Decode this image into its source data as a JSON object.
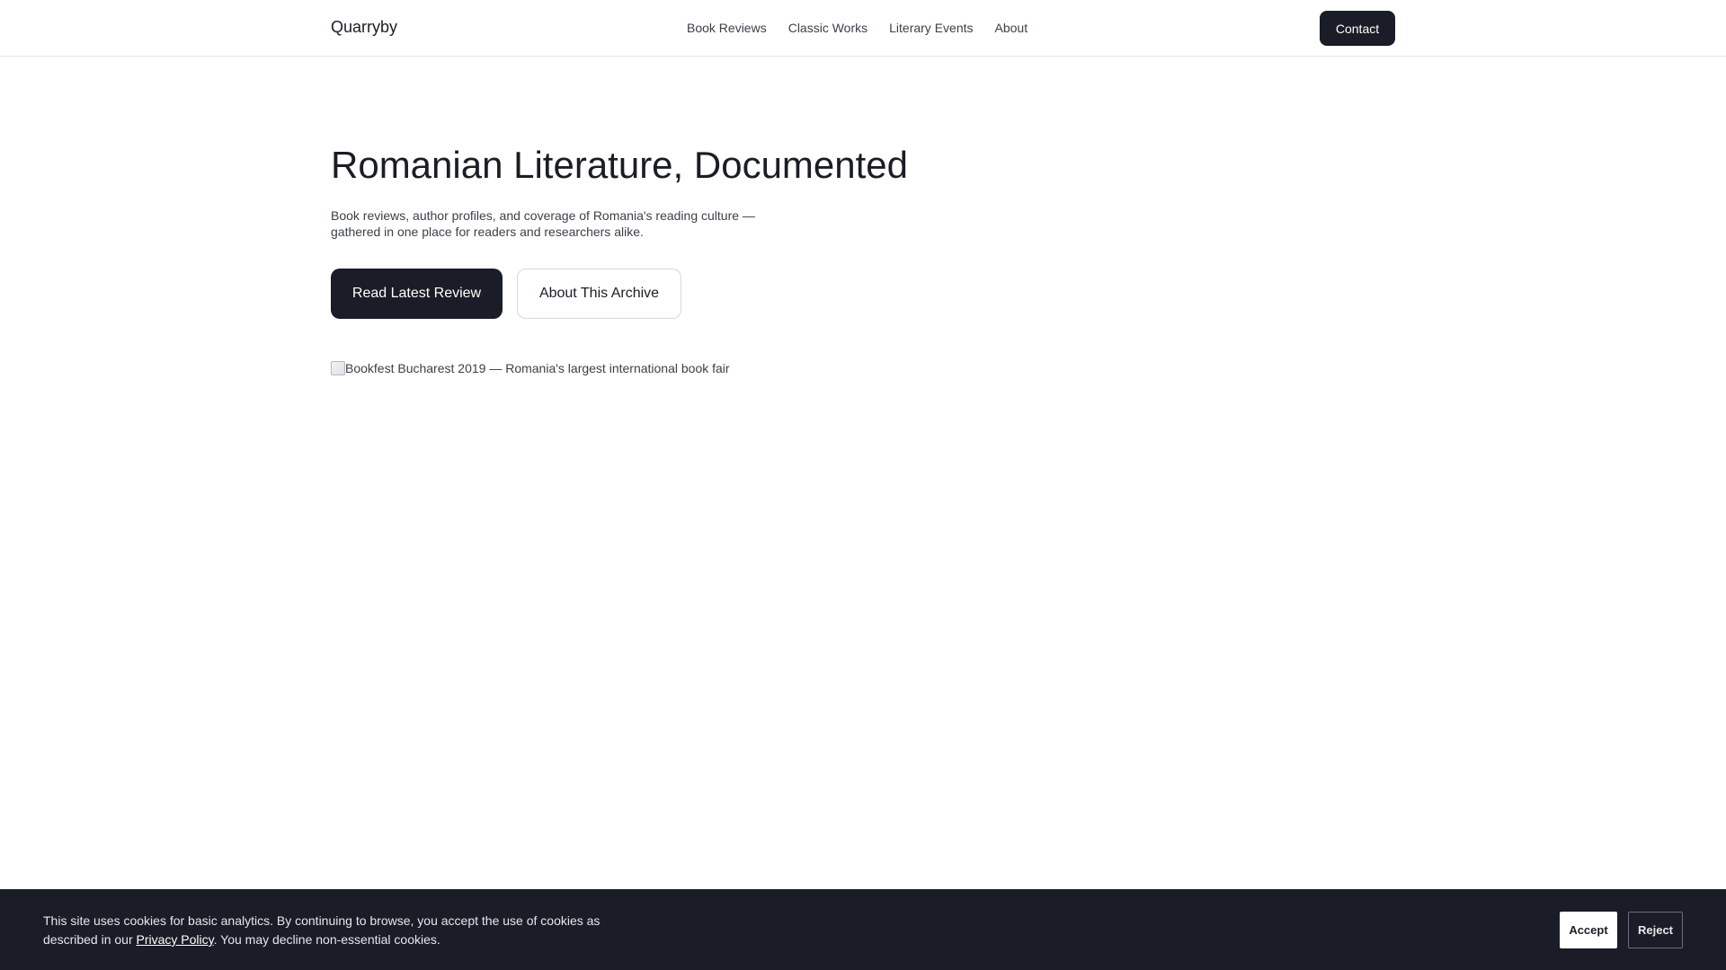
{
  "header": {
    "brand": "Quarryby",
    "nav": [
      {
        "label": "Book Reviews"
      },
      {
        "label": "Classic Works"
      },
      {
        "label": "Literary Events"
      },
      {
        "label": "About"
      }
    ],
    "contact_label": "Contact"
  },
  "hero": {
    "title": "Romanian Literature, Documented",
    "subtitle": "Book reviews, author profiles, and coverage of Romania's reading culture — gathered in one place for readers and researchers alike.",
    "primary_label": "Read Latest Review",
    "secondary_label": "About This Archive",
    "image_alt": "Bookfest Bucharest 2019 — Romania's largest international book fair",
    "image_icon": "broken-image-icon"
  },
  "cookie": {
    "text_before": "This site uses cookies for basic analytics. By continuing to browse, you accept the use of cookies as described in our ",
    "privacy_link": "Privacy Policy",
    "text_after": ". You may decline non-essential cookies.",
    "accept_label": "Accept",
    "reject_label": "Reject"
  },
  "colors": {
    "dark": "#1a1d27",
    "text": "#1a1d24",
    "muted": "#3b3f47",
    "border": "#e2e4e8",
    "background": "#ffffff"
  }
}
